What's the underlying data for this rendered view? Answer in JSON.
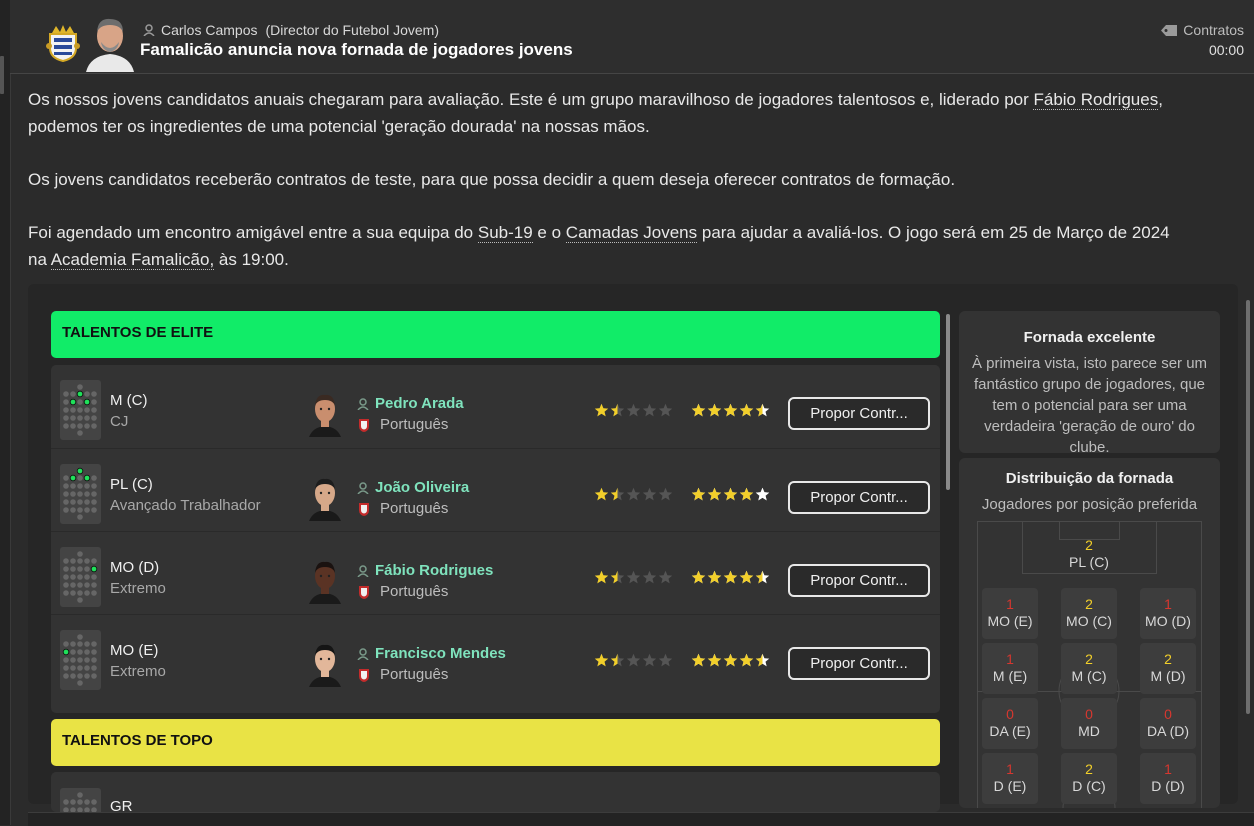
{
  "header": {
    "sender_name": "Carlos Campos",
    "sender_role": "(Director do Futebol Jovem)",
    "subject": "Famalicão anuncia nova fornada de jogadores jovens",
    "tag": "Contratos",
    "time": "00:00"
  },
  "body": {
    "p1_a": "Os nossos jovens candidatos anuais chegaram para avaliação. Este é um grupo maravilhoso de jogadores talentosos e, liderado por ",
    "p1_link": "Fábio Rodrigues",
    "p1_b": ",",
    "p1_c": "podemos ter os ingredientes de uma potencial 'geração dourada' na nossas mãos.",
    "p2": "Os jovens candidatos receberão contratos de teste, para que possa decidir a quem deseja oferecer contratos de formação.",
    "p3_a": "Foi agendado um encontro amigável entre a sua equipa do ",
    "p3_link1": "Sub-19",
    "p3_b": " e o ",
    "p3_link2": "Camadas Jovens",
    "p3_c": " para ajudar a avaliá-los. O jogo será em 25 de Março de 2024",
    "p3_d": "na ",
    "p3_link3": "Academia Famalicão,",
    "p3_e": " às 19:00."
  },
  "sections": {
    "elite": "TALENTOS DE ELITE",
    "topo": "TALENTOS DE TOPO"
  },
  "players": [
    {
      "position": "M (C)",
      "role": "CJ",
      "name": "Pedro Arada",
      "nationality": "Português",
      "current_ability_stars": 1.5,
      "potential_ability_stars": 4.5,
      "button": "Propor Contr..."
    },
    {
      "position": "PL (C)",
      "role": "Avançado Trabalhador",
      "name": "João Oliveira",
      "nationality": "Português",
      "current_ability_stars": 1.5,
      "potential_ability_stars": 5,
      "button": "Propor Contr..."
    },
    {
      "position": "MO (D)",
      "role": "Extremo",
      "name": "Fábio Rodrigues",
      "nationality": "Português",
      "current_ability_stars": 1.5,
      "potential_ability_stars": 4.5,
      "button": "Propor Contr..."
    },
    {
      "position": "MO (E)",
      "role": "Extremo",
      "name": "Francisco Mendes",
      "nationality": "Português",
      "current_ability_stars": 1.5,
      "potential_ability_stars": 4.5,
      "button": "Propor Contr..."
    }
  ],
  "partial_row": {
    "position": "GR"
  },
  "summary": {
    "title": "Fornada excelente",
    "text": "À primeira vista, isto parece ser um fantástico grupo de jogadores, que tem o potencial para ser uma verdadeira 'geração de ouro' do clube."
  },
  "distribution": {
    "title": "Distribuição da fornada",
    "subtitle": "Jogadores por posição preferida",
    "cells": [
      {
        "count": "2",
        "label": "PL (C)"
      },
      {
        "count": "1",
        "label": "MO (E)"
      },
      {
        "count": "2",
        "label": "MO (C)"
      },
      {
        "count": "1",
        "label": "MO (D)"
      },
      {
        "count": "1",
        "label": "M (E)"
      },
      {
        "count": "2",
        "label": "M (C)"
      },
      {
        "count": "2",
        "label": "M (D)"
      },
      {
        "count": "0",
        "label": "DA (E)"
      },
      {
        "count": "0",
        "label": "MD"
      },
      {
        "count": "0",
        "label": "DA (D)"
      },
      {
        "count": "1",
        "label": "D (E)"
      },
      {
        "count": "2",
        "label": "D (C)"
      },
      {
        "count": "1",
        "label": "D (D)"
      }
    ]
  },
  "colors": {
    "elite": "#11ec68",
    "topo": "#e9e345",
    "star": "#f2cf2a",
    "player_name": "#7fe3bd",
    "count_low": "#d6372f",
    "count_high": "#f2cf2a"
  },
  "icons": [
    "club-crest-icon",
    "person-icon",
    "contract-tag-icon",
    "star-icon",
    "portugal-crest-icon"
  ]
}
